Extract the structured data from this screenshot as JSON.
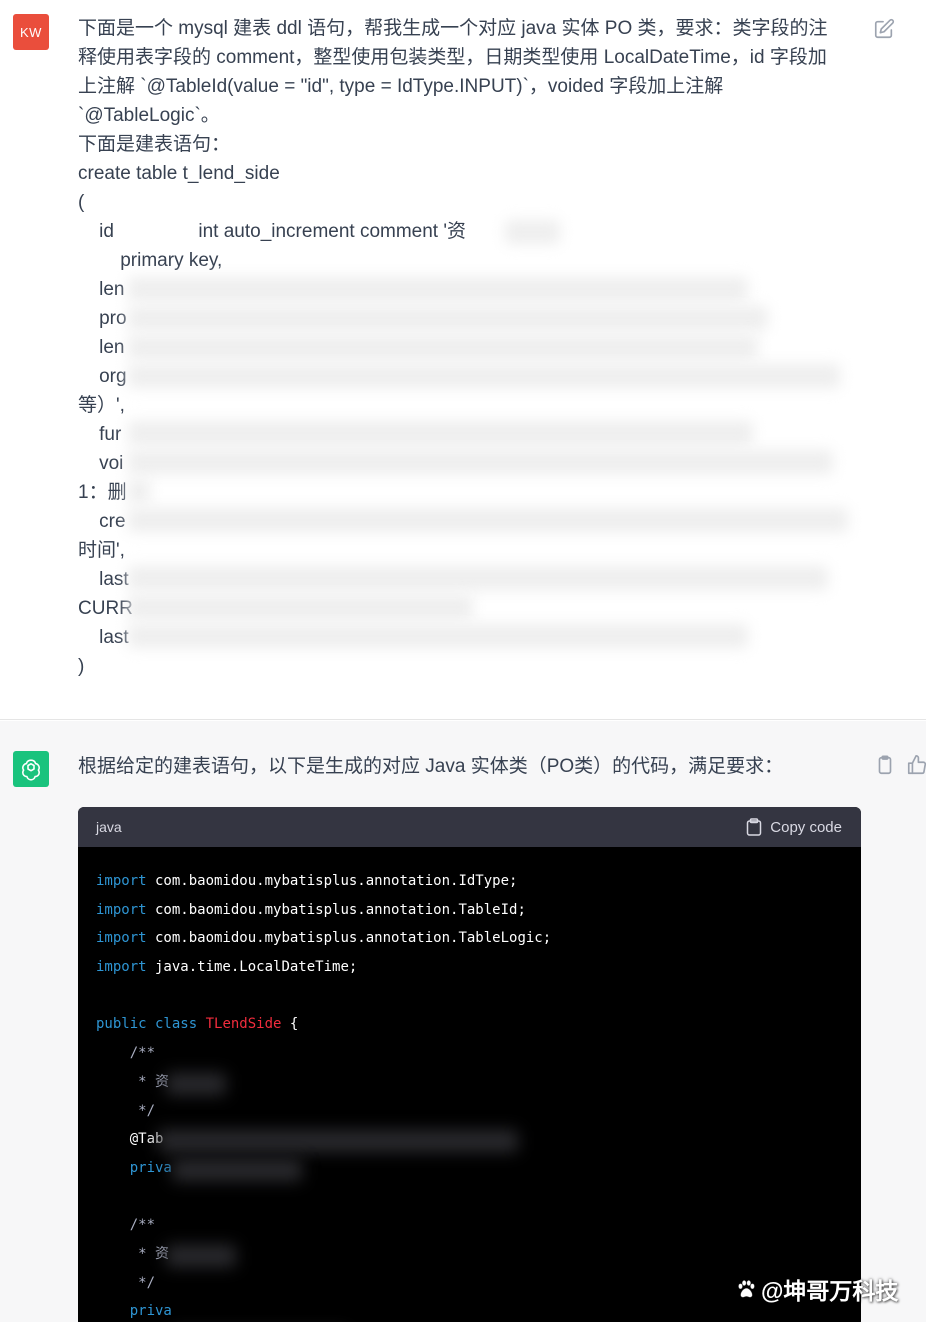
{
  "user": {
    "avatar_initials": "KW",
    "lines": [
      "下面是一个 mysql 建表 ddl 语句，帮我生成一个对应 java 实体 PO 类，要求：类字段的注",
      "释使用表字段的 comment，整型使用包装类型，日期类型使用 LocalDateTime，id 字段加",
      "上注解 `@TableId(value = \"id\", type = IdType.INPUT)`，voided 字段加上注解",
      "`@TableLogic`。",
      "下面是建表语句：",
      "create table t_lend_side",
      "(",
      "    id                int auto_increment comment '资",
      "        primary key,",
      "    len",
      "    pro",
      "    len",
      "    org",
      "等）',",
      "    fur",
      "    voi",
      "1：删",
      "    cre",
      "时间',",
      "    last",
      "CURR",
      "    last",
      ")"
    ]
  },
  "assistant": {
    "intro": "根据给定的建表语句，以下是生成的对应 Java 实体类（PO类）的代码，满足要求：",
    "code_language": "java",
    "copy_label": "Copy code",
    "imports": [
      {
        "kw": "import",
        "rest": " com.baomidou.mybatisplus.annotation.IdType;"
      },
      {
        "kw": "import",
        "rest": " com.baomidou.mybatisplus.annotation.TableId;"
      },
      {
        "kw": "import",
        "rest": " com.baomidou.mybatisplus.annotation.TableLogic;"
      },
      {
        "kw": "import",
        "rest": " java.time.LocalDateTime;"
      }
    ],
    "class_kw": "public class",
    "class_name": "TLendSide",
    "class_open": " {",
    "body_lines": [
      "    /**",
      "     * 资",
      "     */",
      "    @Tab",
      "    priva",
      "",
      "    /**",
      "     * 资",
      "     */",
      "    priva"
    ]
  },
  "watermark": "@坤哥万科技",
  "colors": {
    "user_avatar": "#ea4e3c",
    "gpt_avatar": "#19c37d",
    "code_keyword": "#2e95d3",
    "code_class": "#f22c3d"
  }
}
